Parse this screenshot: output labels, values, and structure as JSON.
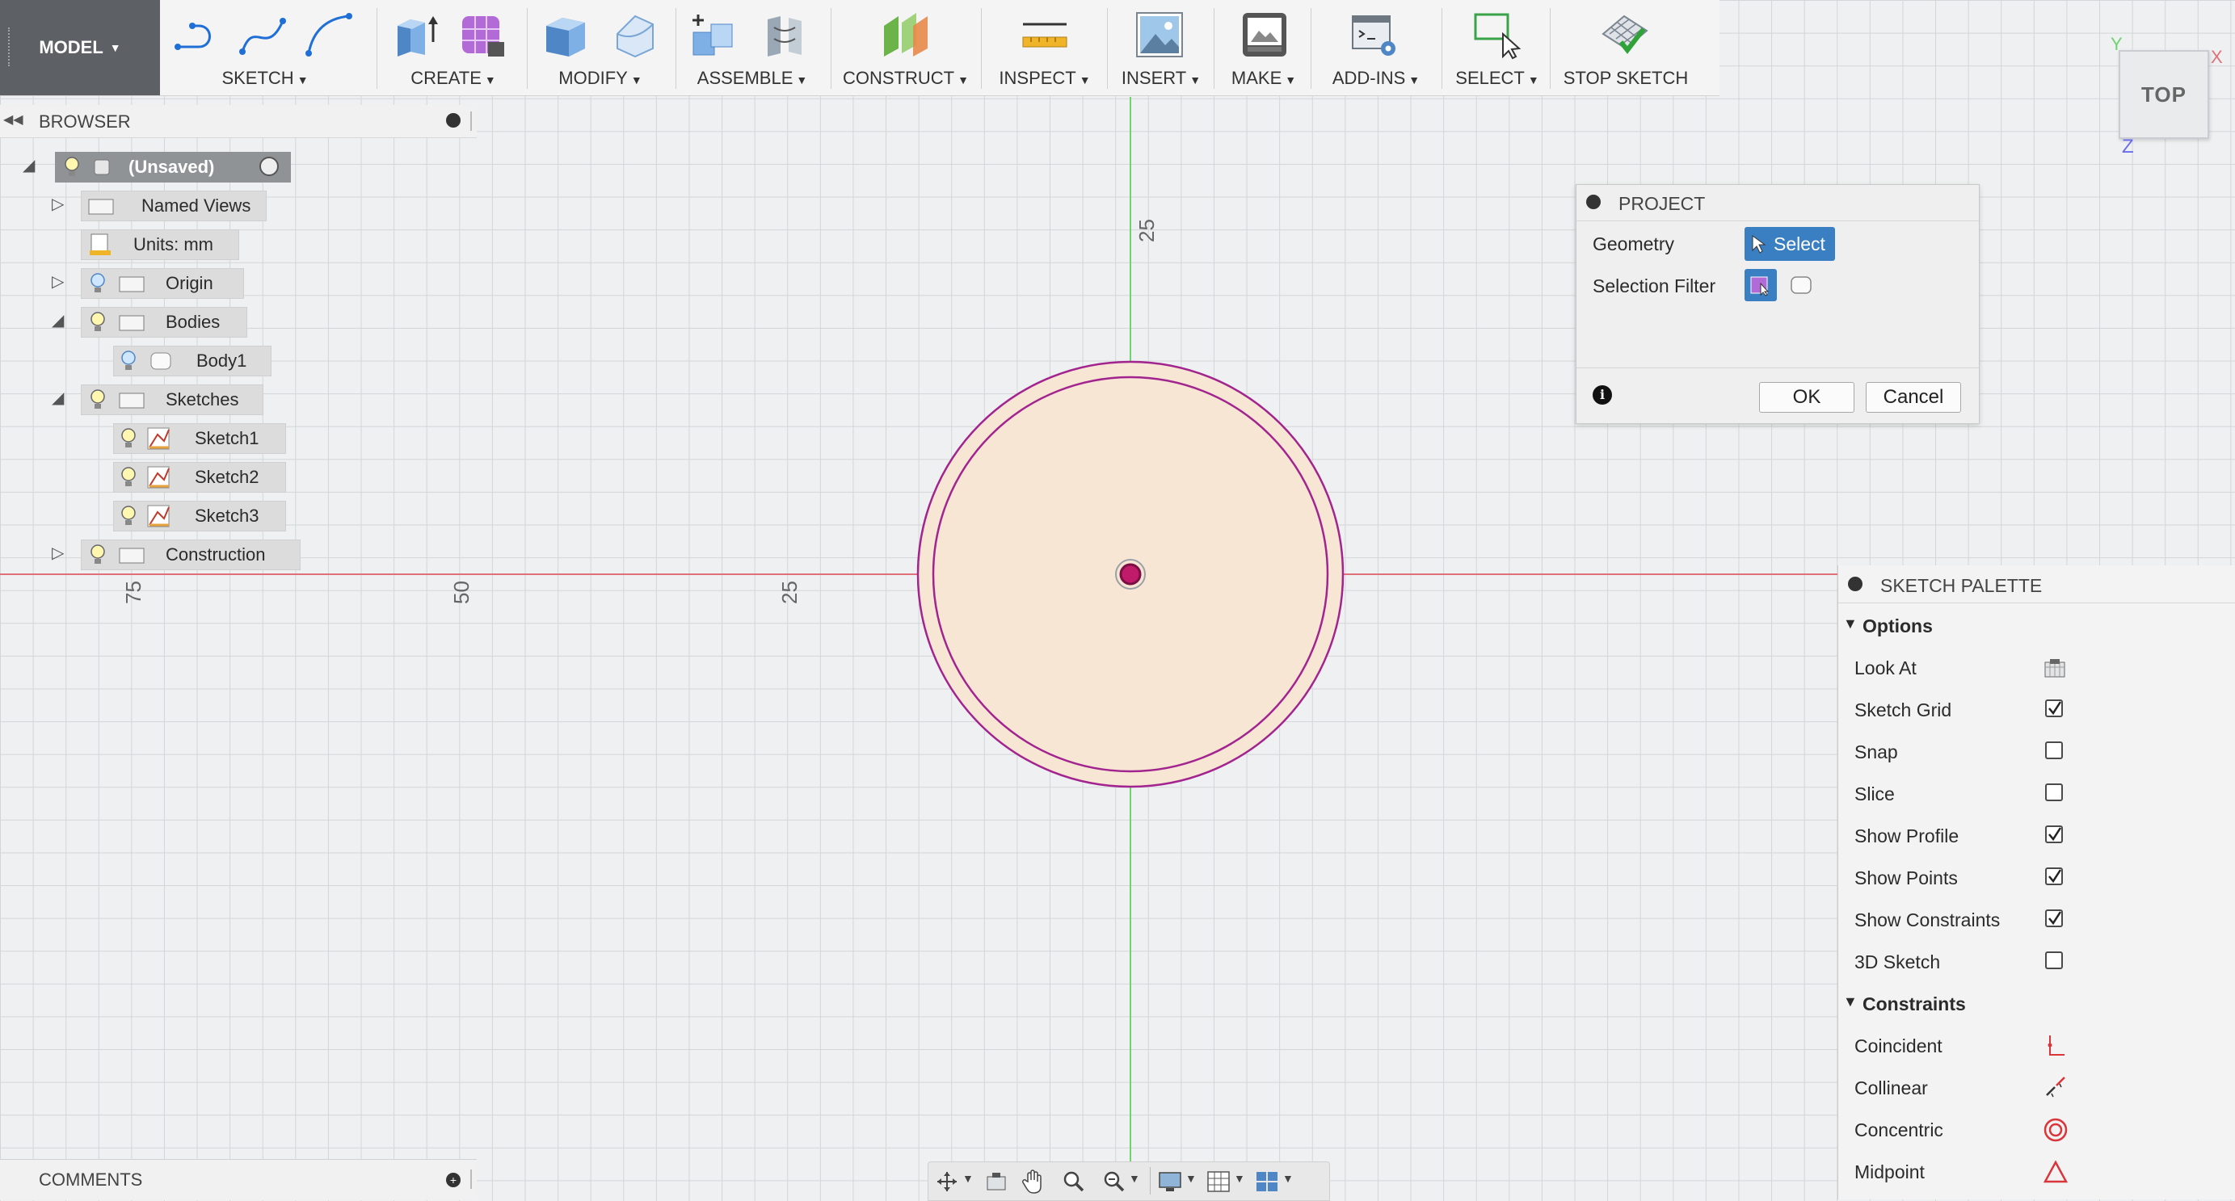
{
  "toolbar": {
    "model": "MODEL",
    "groups": [
      "SKETCH",
      "CREATE",
      "MODIFY",
      "ASSEMBLE",
      "CONSTRUCT",
      "INSPECT",
      "INSERT",
      "MAKE",
      "ADD-INS",
      "SELECT"
    ],
    "stop_sketch": "STOP SKETCH"
  },
  "browser": {
    "title": "BROWSER",
    "root": "(Unsaved)",
    "items": [
      "Named Views",
      "Units: mm",
      "Origin",
      "Bodies",
      "Body1",
      "Sketches",
      "Sketch1",
      "Sketch2",
      "Sketch3",
      "Construction"
    ]
  },
  "canvas": {
    "axis_labels": [
      "75",
      "50",
      "25",
      "25"
    ],
    "colors": {
      "x_axis": "#e0707a",
      "y_axis": "#6fd36f",
      "profile_fill": "#f8e6d5",
      "circle_stroke": "#a2248f"
    }
  },
  "project_dialog": {
    "title": "PROJECT",
    "geometry_label": "Geometry",
    "select_label": "Select",
    "filter_label": "Selection Filter",
    "ok": "OK",
    "cancel": "Cancel"
  },
  "palette": {
    "title": "SKETCH PALETTE",
    "options_header": "Options",
    "options": [
      {
        "label": "Look At"
      },
      {
        "label": "Sketch Grid",
        "checked": true
      },
      {
        "label": "Snap",
        "checked": false
      },
      {
        "label": "Slice",
        "checked": false
      },
      {
        "label": "Show Profile",
        "checked": true
      },
      {
        "label": "Show Points",
        "checked": true
      },
      {
        "label": "Show Constraints",
        "checked": true
      },
      {
        "label": "3D Sketch",
        "checked": false
      }
    ],
    "constraints_header": "Constraints",
    "constraints": [
      "Coincident",
      "Collinear",
      "Concentric",
      "Midpoint"
    ]
  },
  "comments": {
    "title": "COMMENTS"
  },
  "viewcube": {
    "face": "TOP",
    "axes": [
      "Y",
      "X",
      "Z"
    ]
  }
}
